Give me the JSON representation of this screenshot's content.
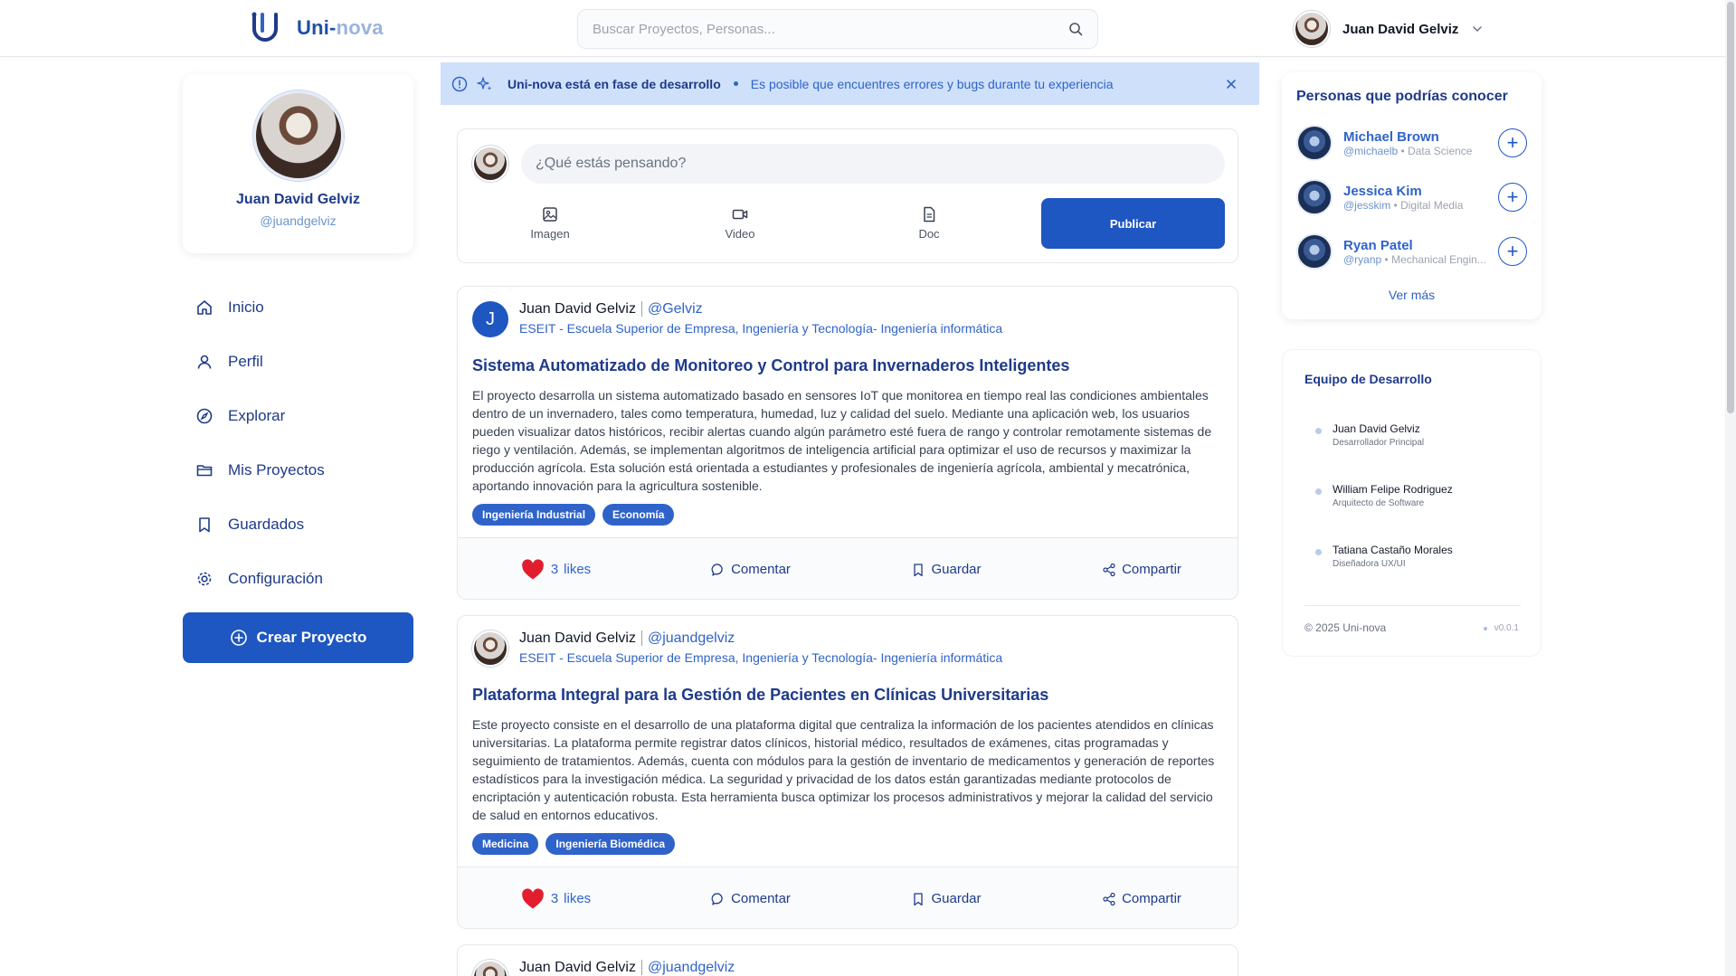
{
  "header": {
    "brand_prefix": "Uni-",
    "brand_suffix": "nova",
    "search_placeholder": "Buscar Proyectos, Personas...",
    "user_name": "Juan David Gelviz"
  },
  "profile": {
    "name": "Juan David Gelviz",
    "handle": "@juandgelviz"
  },
  "nav": {
    "items": [
      {
        "label": "Inicio",
        "icon": "home-icon"
      },
      {
        "label": "Perfil",
        "icon": "user-icon"
      },
      {
        "label": "Explorar",
        "icon": "compass-icon"
      },
      {
        "label": "Mis Proyectos",
        "icon": "folder-icon"
      },
      {
        "label": "Guardados",
        "icon": "bookmark-icon"
      },
      {
        "label": "Configuración",
        "icon": "gear-icon"
      }
    ],
    "create_label": "Crear Proyecto"
  },
  "banner": {
    "title": "Uni-nova está en fase de desarrollo",
    "message": "Es posible que encuentres errores y bugs durante tu experiencia"
  },
  "composer": {
    "placeholder": "¿Qué estás pensando?",
    "actions": [
      "Imagen",
      "Video",
      "Doc"
    ],
    "publish_label": "Publicar"
  },
  "posts": [
    {
      "author": "Juan David Gelviz",
      "handle": "@Gelviz",
      "avatar_letter": "J",
      "institution": "ESEIT - Escuela Superior de Empresa, Ingeniería y Tecnología- Ingeniería informática",
      "title": "Sistema Automatizado de Monitoreo y Control para Invernaderos Inteligentes",
      "body": "El proyecto desarrolla un sistema automatizado basado en sensores IoT que monitorea en tiempo real las condiciones ambientales dentro de un invernadero, tales como temperatura, humedad, luz y calidad del suelo. Mediante una aplicación web, los usuarios pueden visualizar datos históricos, recibir alertas cuando algún parámetro esté fuera de rango y controlar remotamente sistemas de riego y ventilación. Además, se implementan algoritmos de inteligencia artificial para optimizar el uso de recursos y maximizar la producción agrícola. Esta solución está orientada a estudiantes y profesionales de ingeniería agrícola, ambiental y mecatrónica, aportando innovación para la agricultura sostenible.",
      "tags": [
        "Ingeniería Industrial",
        "Economía"
      ],
      "likes": "3",
      "likes_label": "likes",
      "comment_label": "Comentar",
      "save_label": "Guardar",
      "share_label": "Compartir"
    },
    {
      "author": "Juan David Gelviz",
      "handle": "@juandgelviz",
      "institution": "ESEIT - Escuela Superior de Empresa, Ingeniería y Tecnología- Ingeniería informática",
      "title": "Plataforma Integral para la Gestión de Pacientes en Clínicas Universitarias",
      "body": "Este proyecto consiste en el desarrollo de una plataforma digital que centraliza la información de los pacientes atendidos en clínicas universitarias. La plataforma permite registrar datos clínicos, historial médico, resultados de exámenes, citas programadas y seguimiento de tratamientos. Además, cuenta con módulos para la gestión de inventario de medicamentos y generación de reportes estadísticos para la investigación médica. La seguridad y privacidad de los datos están garantizadas mediante protocolos de encriptación y autenticación robusta. Esta herramienta busca optimizar los procesos administrativos y mejorar la calidad del servicio de salud en entornos educativos.",
      "tags": [
        "Medicina",
        "Ingeniería Biomédica"
      ],
      "likes": "3",
      "likes_label": "likes",
      "comment_label": "Comentar",
      "save_label": "Guardar",
      "share_label": "Compartir"
    },
    {
      "author": "Juan David Gelviz",
      "handle": "@juandgelviz"
    }
  ],
  "suggestions": {
    "title": "Personas que podrías conocer",
    "people": [
      {
        "name": "Michael Brown",
        "handle": "@michaelb",
        "field": "Data Science"
      },
      {
        "name": "Jessica Kim",
        "handle": "@jesskim",
        "field": "Digital Media"
      },
      {
        "name": "Ryan Patel",
        "handle": "@ryanp",
        "field": "Mechanical Engin..."
      }
    ],
    "more_label": "Ver más"
  },
  "team": {
    "title": "Equipo de Desarrollo",
    "members": [
      {
        "name": "Juan David Gelviz",
        "role": "Desarrollador Principal"
      },
      {
        "name": "William Felipe Rodriguez",
        "role": "Arquitecto de Software"
      },
      {
        "name": "Tatiana Castaño Morales",
        "role": "Diseñadora UX/UI"
      }
    ],
    "copyright": "© 2025 Uni-nova",
    "version": "v0.0.1"
  },
  "colors": {
    "primary": "#1e56c2",
    "heading": "#1e3a8a",
    "banner_bg": "#cfe0fa",
    "like": "#e11d2e"
  }
}
